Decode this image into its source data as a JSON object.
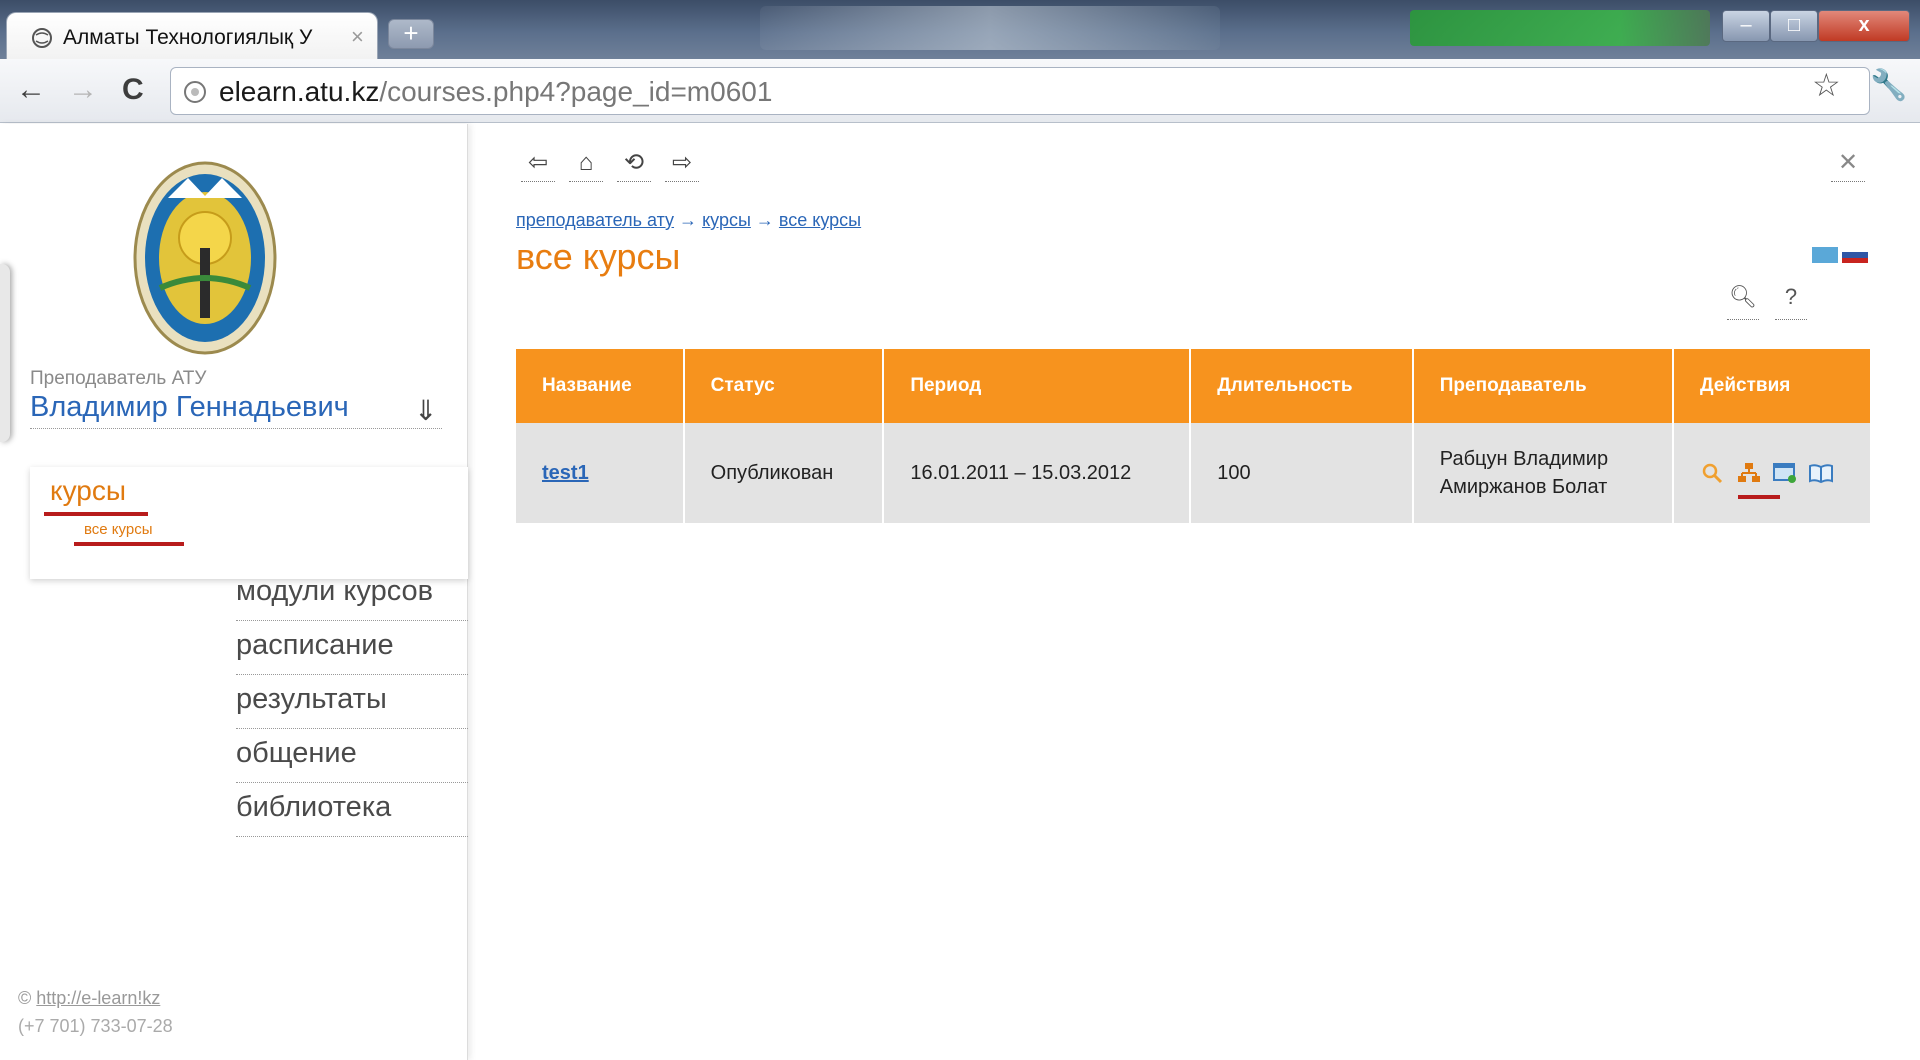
{
  "browser": {
    "tab_title": "Алматы Технологиялық У",
    "tab_close": "×",
    "new_tab": "+",
    "url_host": "elearn.atu.kz",
    "url_path": "/courses.php4?page_id=m0601",
    "win_min": "–",
    "win_max": "□",
    "win_close": "x"
  },
  "sidebar": {
    "role": "Преподаватель АТУ",
    "user_name": "Владимир Геннадьевич",
    "menu_courses": "курсы",
    "menu_all_courses": "все курсы",
    "menu": [
      "модули курсов",
      "расписание",
      "результаты",
      "общение",
      "библиотека"
    ],
    "footer_copyright": "©",
    "footer_link": "http://e-learn!kz",
    "footer_phone": "(+7 701) 733-07-28"
  },
  "main": {
    "breadcrumb": [
      "преподаватель ату",
      "курсы",
      "все курсы"
    ],
    "breadcrumb_sep": "→",
    "page_title": "все курсы",
    "table": {
      "headers": [
        "Название",
        "Статус",
        "Период",
        "Длительность",
        "Преподаватель",
        "Действия"
      ],
      "rows": [
        {
          "name": "test1",
          "status": "Опубликован",
          "period": "16.01.2011 – 15.03.2012",
          "duration": "100",
          "teacher_1": "Рабцун Владимир",
          "teacher_2": "Амиржанов Болат"
        }
      ]
    }
  },
  "colors": {
    "accent_orange": "#f7931e",
    "title_orange": "#e87d10",
    "link_blue": "#2a66b7",
    "underline_red": "#b81c1c"
  },
  "icons": [
    "back-arrow-icon",
    "home-icon",
    "refresh-icon",
    "forward-arrow-icon",
    "close-icon",
    "search-icon",
    "help-icon",
    "magnifier-icon",
    "structure-icon",
    "window-icon",
    "book-icon"
  ]
}
